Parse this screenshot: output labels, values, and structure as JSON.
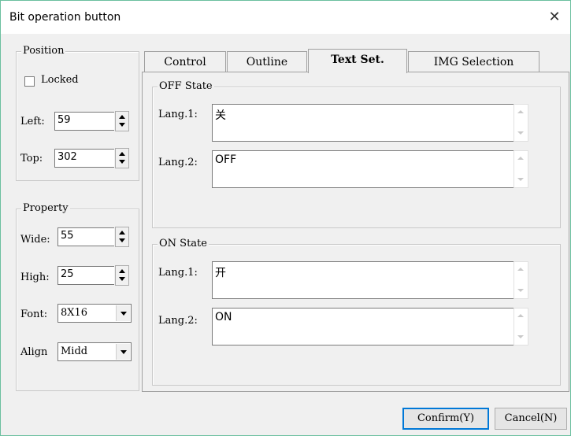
{
  "window": {
    "title": "Bit operation button",
    "close_glyph": "✕"
  },
  "position": {
    "label": "Position",
    "locked_label": "Locked",
    "locked_checked": false,
    "left_label": "Left:",
    "left_value": "59",
    "top_label": "Top:",
    "top_value": "302"
  },
  "property": {
    "label": "Property",
    "wide_label": "Wide:",
    "wide_value": "55",
    "high_label": "High:",
    "high_value": "25",
    "font_label": "Font:",
    "font_value": "8X16",
    "align_label": "Align",
    "align_value": "Midd"
  },
  "tabs": [
    {
      "label": "Control",
      "active": false
    },
    {
      "label": "Outline",
      "active": false
    },
    {
      "label": "Text Set.",
      "active": true
    },
    {
      "label": "IMG Selection",
      "active": false
    }
  ],
  "off_state": {
    "label": "OFF State",
    "lang1_label": "Lang.1:",
    "lang1_value": "关",
    "lang2_label": "Lang.2:",
    "lang2_value": "OFF"
  },
  "on_state": {
    "label": "ON State",
    "lang1_label": "Lang.1:",
    "lang1_value": "开",
    "lang2_label": "Lang.2:",
    "lang2_value": "ON"
  },
  "buttons": {
    "confirm": "Confirm(Y)",
    "cancel": "Cancel(N)"
  },
  "colors": {
    "border_accent": "#6bbf9f",
    "default_button_border": "#0078d7",
    "dialog_bg": "#f0f0f0"
  }
}
